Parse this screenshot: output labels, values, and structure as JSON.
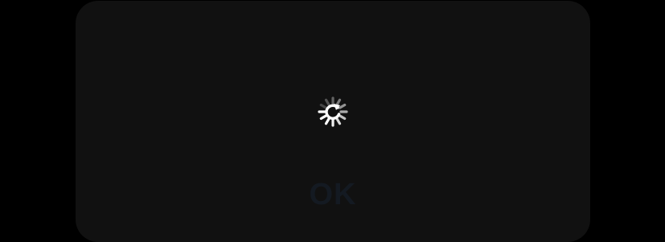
{
  "dialog": {
    "title": "",
    "message": "",
    "ok_label": "OK"
  },
  "loading_indicator": {
    "icon": "spinner-icon",
    "color": "#ffffff"
  },
  "colors": {
    "background": "#000000",
    "dialog_background": "#111111",
    "ok_text": "#141a22"
  }
}
